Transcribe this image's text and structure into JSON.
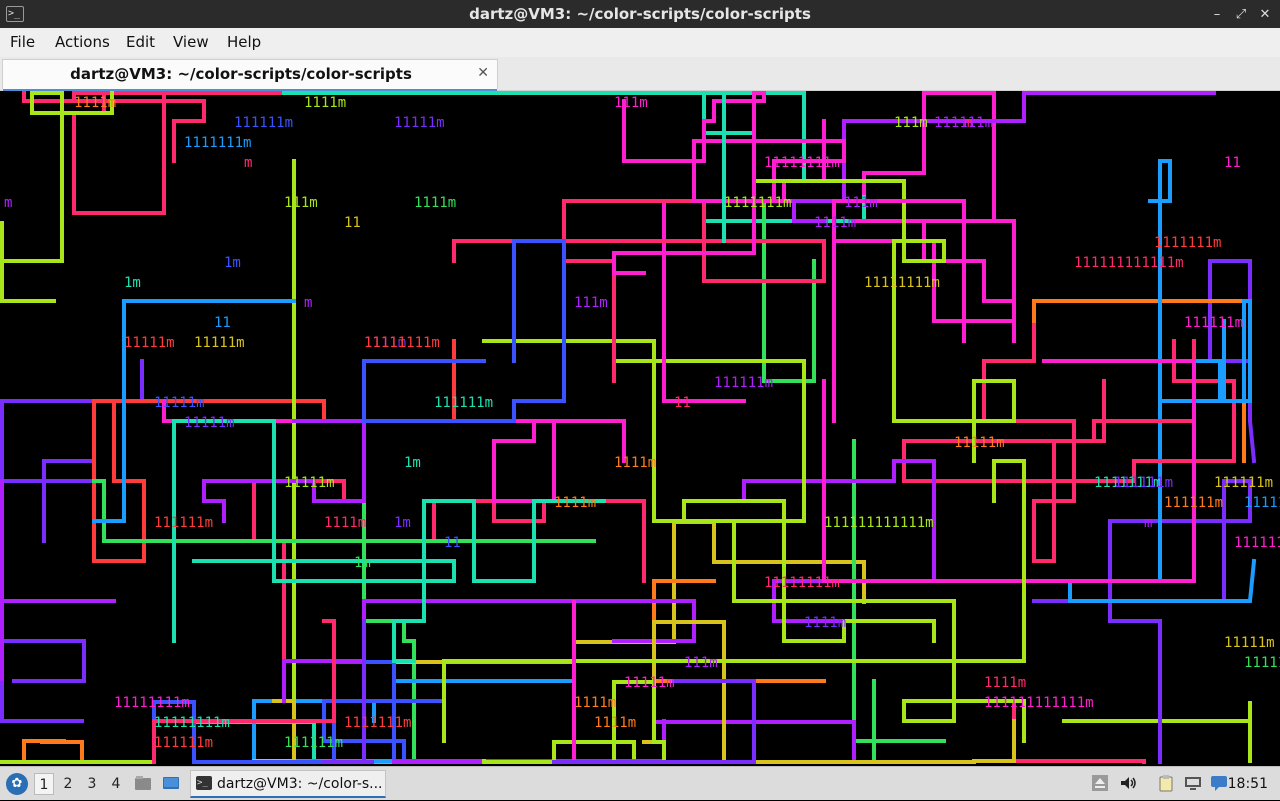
{
  "window": {
    "title": "dartz@VM3: ~/color-scripts/color-scripts",
    "app_icon": "terminal-icon",
    "controls": [
      "minimize-icon",
      "maximize-icon",
      "close-icon"
    ]
  },
  "menubar": {
    "items": [
      "File",
      "Actions",
      "Edit",
      "View",
      "Help"
    ]
  },
  "tabs": [
    {
      "label": "dartz@VM3: ~/color-scripts/color-scripts",
      "close_icon": "close-icon"
    }
  ],
  "terminal": {
    "background": "#000000",
    "palette": [
      "#ff2a6d",
      "#ff3b3b",
      "#ff7a1a",
      "#d8c21c",
      "#a8e61a",
      "#33e05a",
      "#1de0b0",
      "#1a9dff",
      "#3a52ff",
      "#7b2cff",
      "#b01fff",
      "#ff1fd0"
    ],
    "text_fragments": [
      "1m",
      "m",
      "111111111111m",
      "11111m",
      "1111m",
      "1111111m",
      "11111111m",
      "1111m",
      "11",
      "111111m",
      "111m"
    ]
  },
  "taskbar": {
    "menu_icon": "start-menu-icon",
    "workspaces": [
      "1",
      "2",
      "3",
      "4"
    ],
    "active_workspace": "1",
    "launchers": [
      "file-manager-icon",
      "show-desktop-icon"
    ],
    "task": {
      "label": "dartz@VM3: ~/color-s...",
      "icon": "terminal-icon"
    },
    "tray": [
      "eject-icon",
      "volume-icon",
      "clipboard-icon",
      "display-icon",
      "chat-icon"
    ],
    "clock": "18:51"
  }
}
